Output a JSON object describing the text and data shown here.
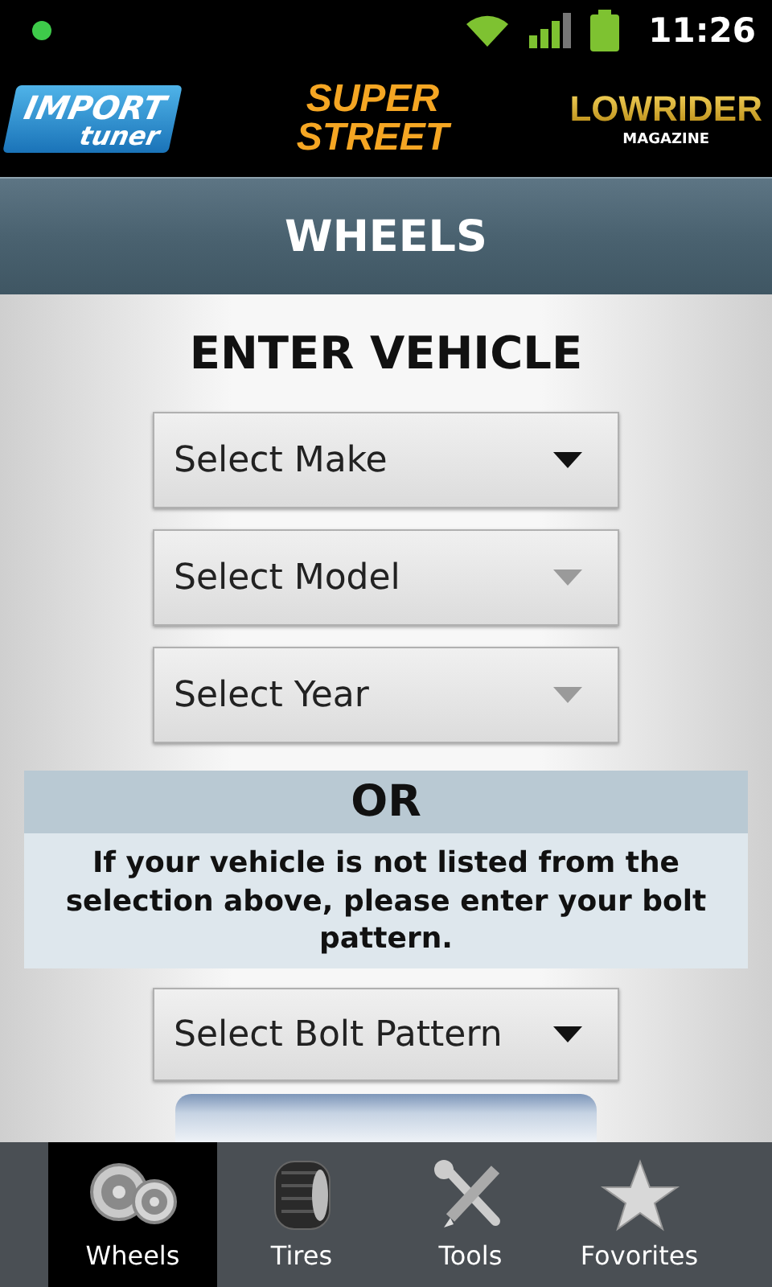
{
  "status_bar": {
    "time": "11:26"
  },
  "logos": [
    {
      "kind": "import",
      "lines": [
        "IMPORT",
        "tuner"
      ]
    },
    {
      "kind": "street",
      "lines": [
        "SUPER",
        "STREET"
      ]
    },
    {
      "kind": "lowrider",
      "lines": [
        "LOWRIDER",
        "MAGAZINE"
      ]
    }
  ],
  "header": {
    "title": "WHEELS"
  },
  "form": {
    "heading": "ENTER VEHICLE",
    "selects": [
      {
        "label": "Select Make",
        "disabled": false
      },
      {
        "label": "Select Model",
        "disabled": true
      },
      {
        "label": "Select Year",
        "disabled": true
      }
    ],
    "or_label": "OR",
    "note": "If your vehicle is not listed from the selection above, please enter your bolt pattern.",
    "bolt_select": {
      "label": "Select Bolt Pattern",
      "disabled": false
    }
  },
  "tabs": [
    {
      "kind": "wheels",
      "label": "Wheels",
      "selected": true
    },
    {
      "kind": "tires",
      "label": "Tires",
      "selected": false
    },
    {
      "kind": "tools",
      "label": "Tools",
      "selected": false
    },
    {
      "kind": "favorites",
      "label": "Fovorites",
      "selected": false
    }
  ]
}
